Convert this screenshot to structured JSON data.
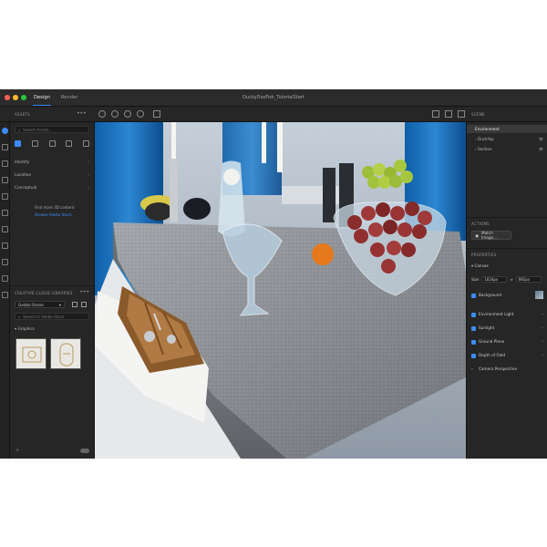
{
  "titlebar": {
    "tabs": [
      {
        "label": "Design"
      },
      {
        "label": "Render"
      }
    ],
    "title": "DuckyDoxFisk_TutorialStart"
  },
  "assets": {
    "header": "ASSETS",
    "search_placeholder": "Search Assets...",
    "rows": [
      {
        "label": "Identify"
      },
      {
        "label": "Location"
      },
      {
        "label": "Conceptual"
      }
    ],
    "empty_line1": "Find more 3D content",
    "empty_link": "Browse Adobe Stock"
  },
  "libraries": {
    "header": "CREATIVE CLOUD LIBRARIES",
    "selected": "Gelato Scene",
    "search_placeholder": "Search in Adobe Stock",
    "group": "Graphics"
  },
  "scene": {
    "header": "SCENE",
    "items": [
      {
        "label": "Environment"
      },
      {
        "label": "DuckYop"
      },
      {
        "label": "Section"
      }
    ]
  },
  "actions": {
    "header": "ACTIONS",
    "match_image": "Match Image..."
  },
  "properties": {
    "header": "PROPERTIES",
    "canvas_label": "Canvas",
    "size_label": "Size",
    "width": "1024px",
    "height": "692px",
    "background_label": "Background",
    "checks": [
      {
        "label": "Environment Light"
      },
      {
        "label": "Sunlight"
      },
      {
        "label": "Ground Plane"
      },
      {
        "label": "Depth of Field"
      },
      {
        "label": "Camera Perspective"
      }
    ]
  },
  "colors": {
    "accent": "#3b8cf5",
    "panel": "#262626",
    "chrome": "#1e1e1e"
  }
}
